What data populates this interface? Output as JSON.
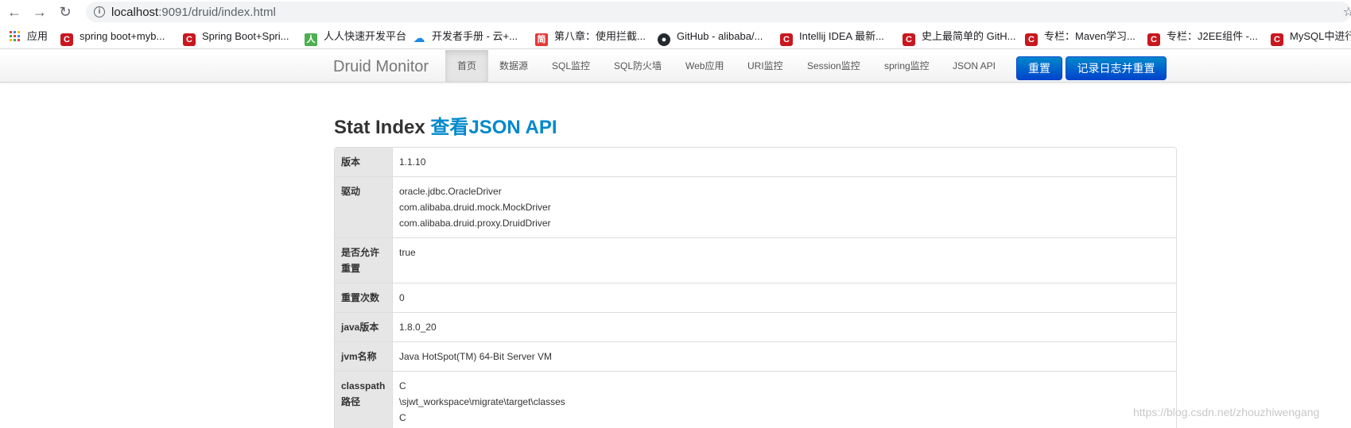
{
  "browser": {
    "url_host": "localhost",
    "url_path": ":9091/druid/index.html",
    "bookmarks": [
      {
        "icon": "apps-grid-icon",
        "label": "应用"
      },
      {
        "icon": "csdn-icon",
        "label": "spring boot+myb..."
      },
      {
        "icon": "csdn-icon",
        "label": "Spring Boot+Spri..."
      },
      {
        "icon": "renren-icon",
        "label": "人人快速开发平台"
      },
      {
        "icon": "cloud-icon",
        "label": "开发者手册 - 云+..."
      },
      {
        "icon": "jianshu-icon",
        "label": "第八章：使用拦截..."
      },
      {
        "icon": "github-icon",
        "label": "GitHub - alibaba/..."
      },
      {
        "icon": "csdn-icon",
        "label": "Intellij IDEA 最新..."
      },
      {
        "icon": "csdn-icon",
        "label": "史上最简单的 GitH..."
      },
      {
        "icon": "csdn-icon",
        "label": "专栏：Maven学习..."
      },
      {
        "icon": "csdn-icon",
        "label": "专栏：J2EE组件 -..."
      },
      {
        "icon": "csdn-icon",
        "label": "MySQL中进行"
      }
    ]
  },
  "navbar": {
    "brand": "Druid Monitor",
    "items": [
      {
        "label": "首页",
        "active": true
      },
      {
        "label": "数据源"
      },
      {
        "label": "SQL监控"
      },
      {
        "label": "SQL防火墙"
      },
      {
        "label": "Web应用"
      },
      {
        "label": "URI监控"
      },
      {
        "label": "Session监控"
      },
      {
        "label": "spring监控"
      },
      {
        "label": "JSON API"
      }
    ],
    "reset_label": "重置",
    "log_reset_label": "记录日志并重置"
  },
  "main": {
    "title": "Stat Index",
    "json_link": "查看JSON API",
    "rows": [
      {
        "key": "版本",
        "value": [
          "1.1.10"
        ]
      },
      {
        "key": "驱动",
        "value": [
          "oracle.jdbc.OracleDriver",
          "com.alibaba.druid.mock.MockDriver",
          "com.alibaba.druid.proxy.DruidDriver"
        ]
      },
      {
        "key": "是否允许重置",
        "value": [
          "true"
        ]
      },
      {
        "key": "重置次数",
        "value": [
          "0"
        ]
      },
      {
        "key": "java版本",
        "value": [
          "1.8.0_20"
        ]
      },
      {
        "key": "jvm名称",
        "value": [
          "Java HotSpot(TM) 64-Bit Server VM"
        ]
      },
      {
        "key": "classpath路径",
        "value": [
          "C",
          "\\sjwt_workspace\\migrate\\target\\classes",
          "C"
        ]
      }
    ]
  },
  "watermark": "https://blog.csdn.net/zhouzhiwengang"
}
